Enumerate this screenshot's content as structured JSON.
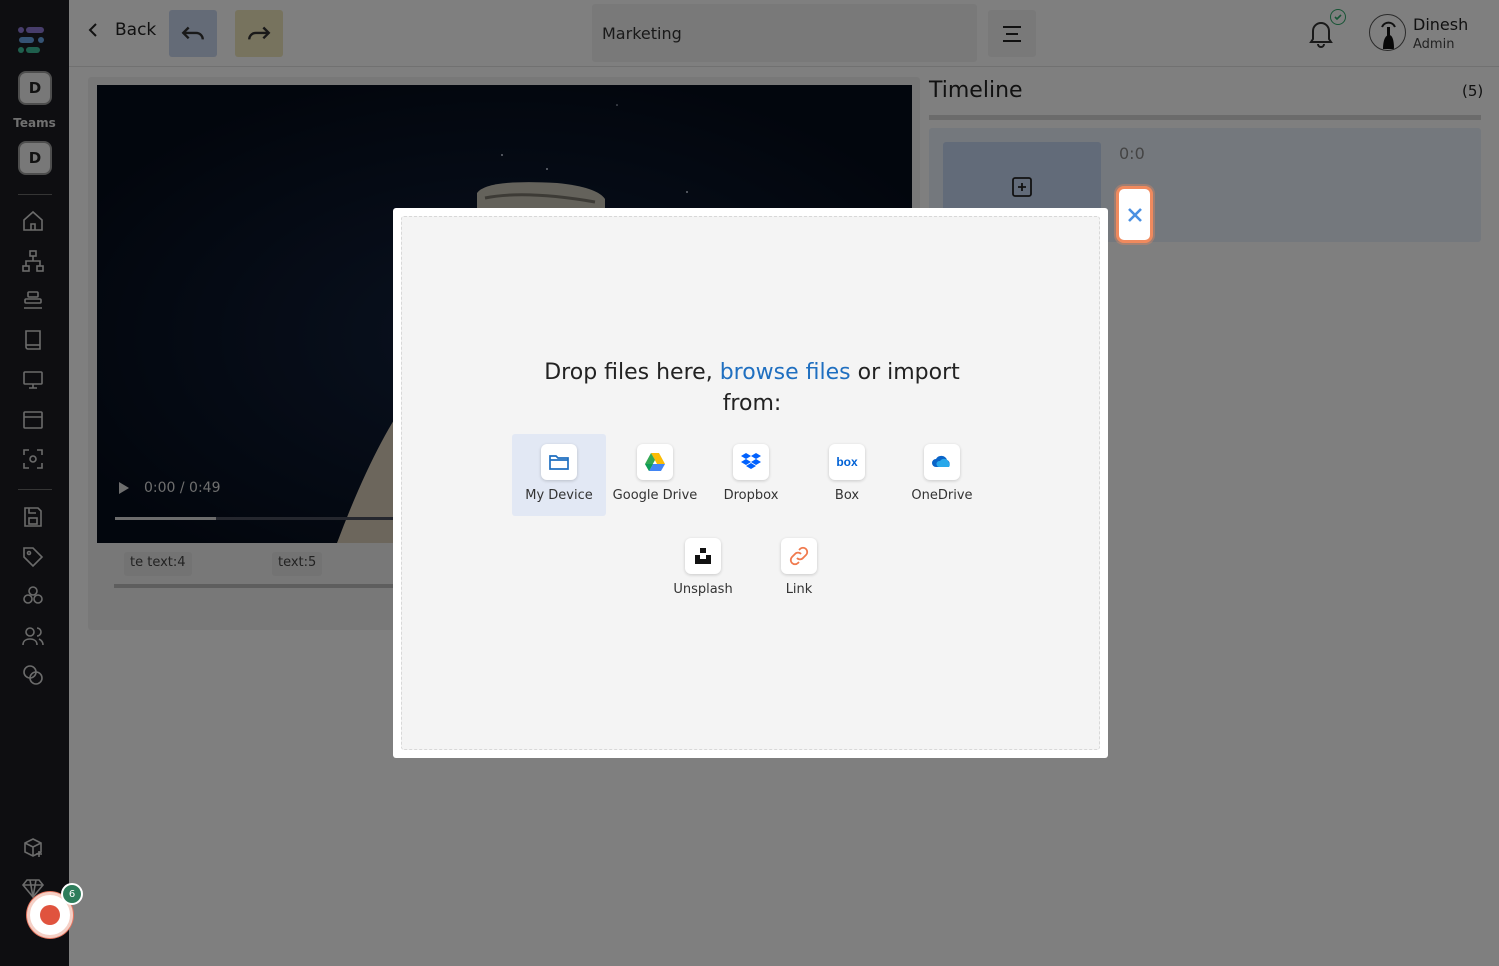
{
  "sidebar": {
    "avatar_top": "D",
    "teams_label": "Teams",
    "avatar_team": "D",
    "nav_icons": [
      "home-icon",
      "hierarchy-icon",
      "stack-icon",
      "book-icon",
      "monitor-icon",
      "browser-icon",
      "scan-icon",
      "save-icon",
      "tag-icon",
      "components-icon",
      "users-icon",
      "coins-icon",
      "package-add-icon",
      "diamond-icon"
    ],
    "record_badge": "6"
  },
  "topbar": {
    "back_label": "Back",
    "project_title": "Marketing",
    "user_name": "Dinesh",
    "user_role": "Admin"
  },
  "video": {
    "time": "0:00 / 0:49",
    "progress_fraction": 0.13
  },
  "clips": [
    {
      "label": "te text:4"
    },
    {
      "label": "text:5"
    }
  ],
  "timeline": {
    "title": "Timeline",
    "count": "(5)",
    "time": "0:0"
  },
  "dialog": {
    "drop_text_1": "Drop files here, ",
    "browse_link": "browse files",
    "drop_text_2": " or import from:",
    "sources": [
      {
        "label": "My Device",
        "icon": "folder-icon"
      },
      {
        "label": "Google Drive",
        "icon": "google-drive-icon"
      },
      {
        "label": "Dropbox",
        "icon": "dropbox-icon"
      },
      {
        "label": "Box",
        "icon": "box-icon"
      },
      {
        "label": "OneDrive",
        "icon": "onedrive-icon"
      },
      {
        "label": "Unsplash",
        "icon": "unsplash-icon"
      },
      {
        "label": "Link",
        "icon": "link-icon"
      }
    ]
  },
  "colors": {
    "sidebar_bg": "#1c1d22",
    "link_blue": "#1f6fc0",
    "close_border": "#f08a5e",
    "record_red": "#e0533e"
  }
}
